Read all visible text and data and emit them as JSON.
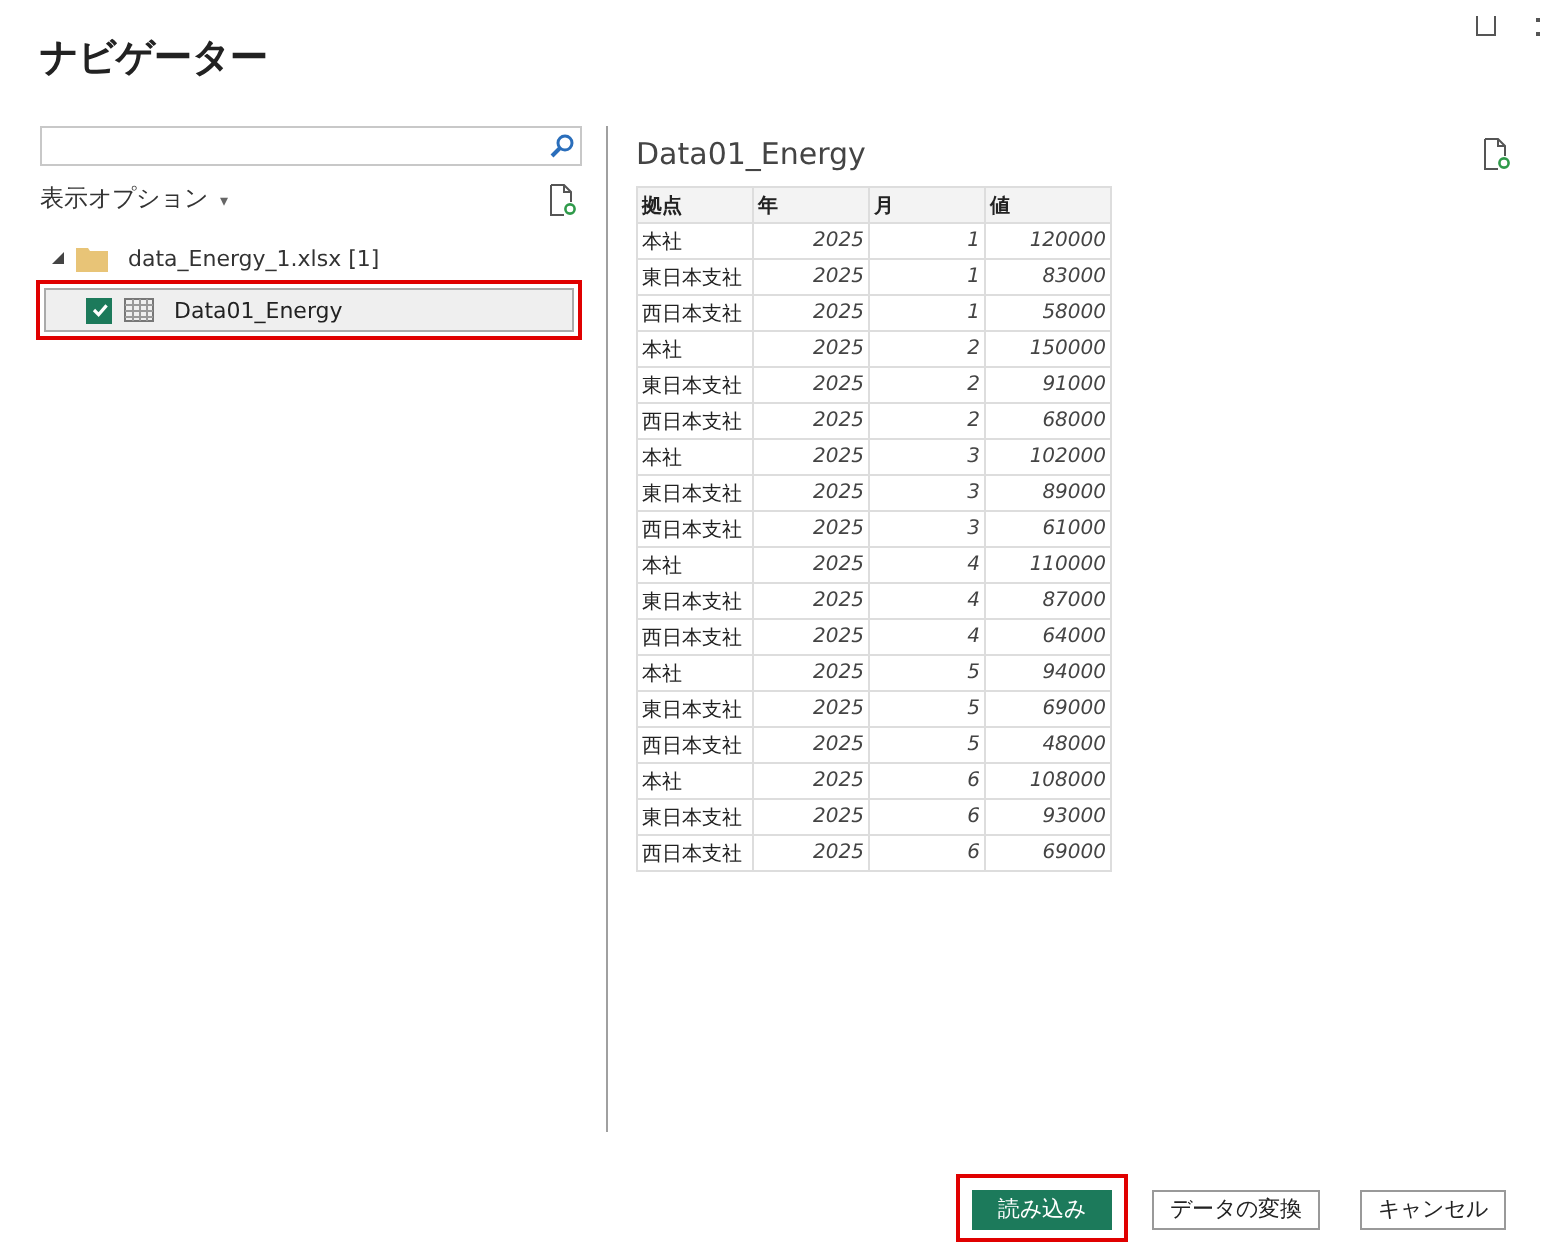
{
  "window": {
    "title": "ナビゲーター"
  },
  "display_options": {
    "label": "表示オプション",
    "caret": "▾"
  },
  "tree": [
    {
      "label": "data_Energy_1.xlsx [1]",
      "expanded": true,
      "children": [
        {
          "label": "Data01_Energy",
          "checked": true,
          "selected": true,
          "highlighted": true
        }
      ]
    }
  ],
  "preview": {
    "title": "Data01_Energy",
    "columns": [
      "拠点",
      "年",
      "月",
      "値"
    ],
    "rows": [
      [
        "本社",
        "2025",
        "1",
        "120000"
      ],
      [
        "東日本支社",
        "2025",
        "1",
        "83000"
      ],
      [
        "西日本支社",
        "2025",
        "1",
        "58000"
      ],
      [
        "本社",
        "2025",
        "2",
        "150000"
      ],
      [
        "東日本支社",
        "2025",
        "2",
        "91000"
      ],
      [
        "西日本支社",
        "2025",
        "2",
        "68000"
      ],
      [
        "本社",
        "2025",
        "3",
        "102000"
      ],
      [
        "東日本支社",
        "2025",
        "3",
        "89000"
      ],
      [
        "西日本支社",
        "2025",
        "3",
        "61000"
      ],
      [
        "本社",
        "2025",
        "4",
        "110000"
      ],
      [
        "東日本支社",
        "2025",
        "4",
        "87000"
      ],
      [
        "西日本支社",
        "2025",
        "4",
        "64000"
      ],
      [
        "本社",
        "2025",
        "5",
        "94000"
      ],
      [
        "東日本支社",
        "2025",
        "5",
        "69000"
      ],
      [
        "西日本支社",
        "2025",
        "5",
        "48000"
      ],
      [
        "本社",
        "2025",
        "6",
        "108000"
      ],
      [
        "東日本支社",
        "2025",
        "6",
        "93000"
      ],
      [
        "西日本支社",
        "2025",
        "6",
        "69000"
      ]
    ]
  },
  "buttons": [
    {
      "label": "読み込み",
      "kind": "primary",
      "highlighted": true
    },
    {
      "label": "データの変換",
      "kind": "normal",
      "highlighted": false
    },
    {
      "label": "キャンセル",
      "kind": "normal",
      "highlighted": false
    }
  ]
}
